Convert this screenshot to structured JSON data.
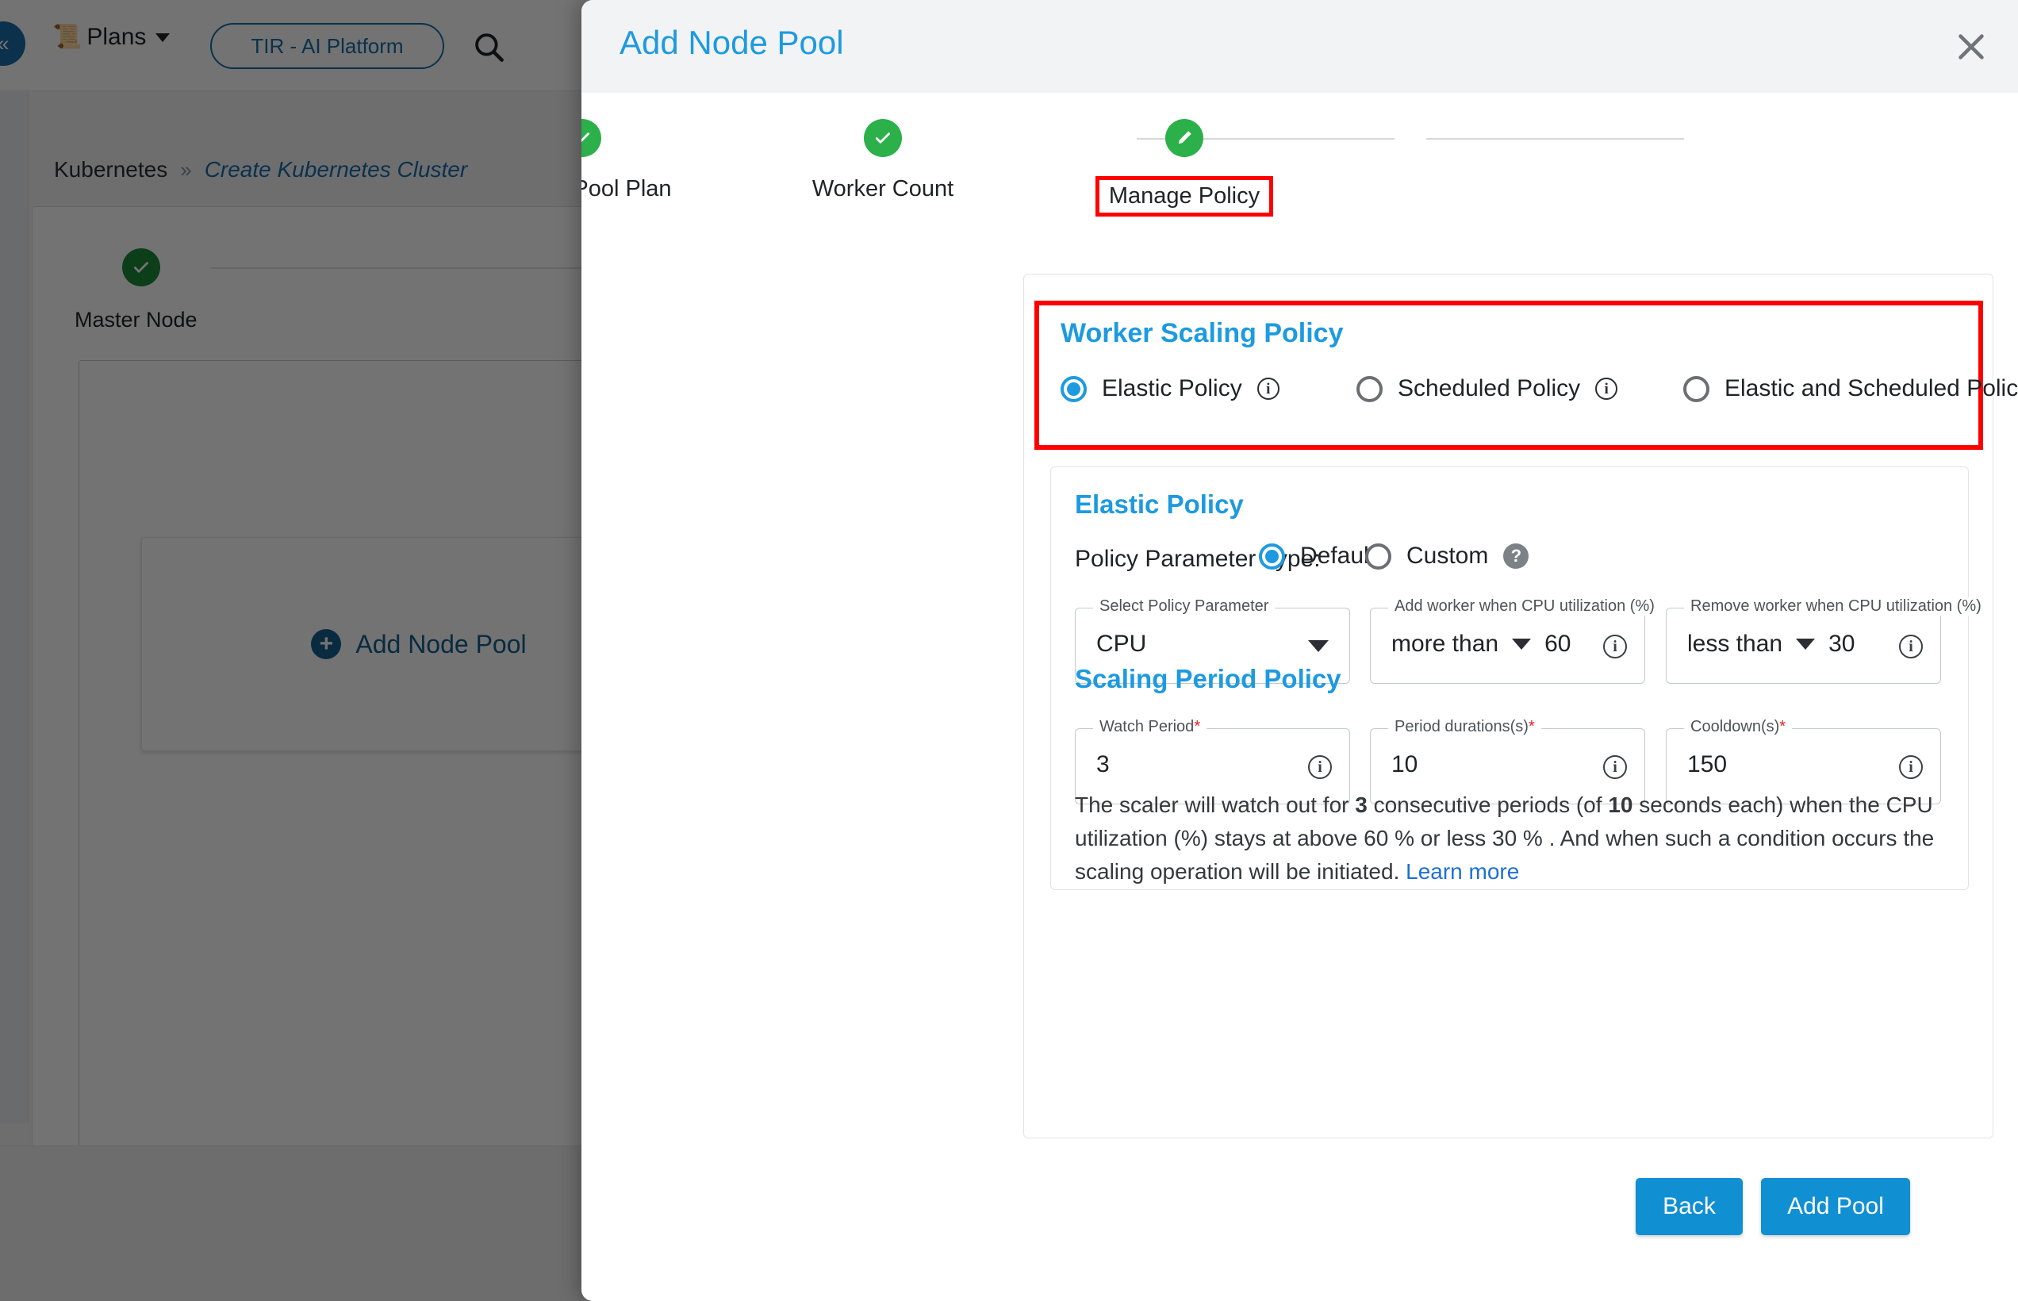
{
  "background": {
    "topbar": {
      "collapse_icon": "double-chevron-left-icon",
      "plans_icon": "list-plans-icon",
      "plans_label": "Plans",
      "plans_caret": "chevron-down-icon",
      "platform_pill": "TIR - AI Platform",
      "search_icon": "search-icon"
    },
    "breadcrumb": {
      "root": "Kubernetes",
      "separator": "»",
      "current": "Create Kubernetes Cluster"
    },
    "master_node_label": "Master Node",
    "add_node_pool_label": "Add Node Pool",
    "add_icon": "plus-circle-icon"
  },
  "modal": {
    "title": "Add Node Pool",
    "close_icon": "close-icon",
    "stepper": [
      {
        "label": "Worker Pool Plan",
        "icon": "check-icon",
        "state": "complete",
        "highlighted": false
      },
      {
        "label": "Worker Count",
        "icon": "check-icon",
        "state": "complete",
        "highlighted": false
      },
      {
        "label": "Manage Policy",
        "icon": "pencil-icon",
        "state": "active",
        "highlighted": true
      }
    ],
    "worker_scaling_policy": {
      "title": "Worker Scaling Policy",
      "highlight_color": "#ff0000",
      "options": [
        {
          "label": "Elastic Policy",
          "selected": true,
          "info_icon": "info-icon"
        },
        {
          "label": "Scheduled Policy",
          "selected": false,
          "info_icon": "info-icon"
        },
        {
          "label": "Elastic and Scheduled Policy",
          "selected": false,
          "info_icon": "info-icon"
        }
      ]
    },
    "elastic_policy": {
      "title": "Elastic Policy",
      "parameter_type_label": "Policy Parameter Type:",
      "parameter_types": [
        {
          "label": "Default",
          "selected": true
        },
        {
          "label": "Custom",
          "selected": false,
          "help_icon": "help-icon"
        }
      ],
      "fields": [
        {
          "legend": "Select Policy Parameter",
          "value": "CPU",
          "control": "select",
          "trailing_icon": "chevron-down-icon"
        },
        {
          "legend": "Add worker when CPU utilization (%)",
          "operator": "more than",
          "value": "60",
          "control": "operator-number",
          "trailing_icon": "info-icon"
        },
        {
          "legend": "Remove worker when CPU utilization (%)",
          "operator": "less than",
          "value": "30",
          "control": "operator-number",
          "trailing_icon": "info-icon"
        }
      ]
    },
    "scaling_period_policy": {
      "title": "Scaling Period Policy",
      "fields": [
        {
          "legend": "Watch Period",
          "required": true,
          "value": "3",
          "trailing_icon": "info-icon"
        },
        {
          "legend": "Period durations(s)",
          "required": true,
          "value": "10",
          "trailing_icon": "info-icon"
        },
        {
          "legend": "Cooldown(s)",
          "required": true,
          "value": "150",
          "trailing_icon": "info-icon"
        }
      ]
    },
    "description": {
      "part1": "The scaler will watch out for ",
      "periods": "3",
      "part2": " consecutive periods (of ",
      "duration": "10",
      "part3": " seconds each) when the CPU utilization (%) stays at above 60 % or less 30 % . And when such a condition occurs the scaling operation will be initiated. ",
      "learn_more": "Learn more"
    },
    "footer": {
      "back_label": "Back",
      "add_label": "Add Pool"
    }
  },
  "colors": {
    "accent_blue": "#1d9ae0",
    "button_blue": "#108fd3",
    "step_green": "#2bb04a",
    "highlight_red": "#ff0000",
    "link_blue": "#1d6fd8"
  }
}
